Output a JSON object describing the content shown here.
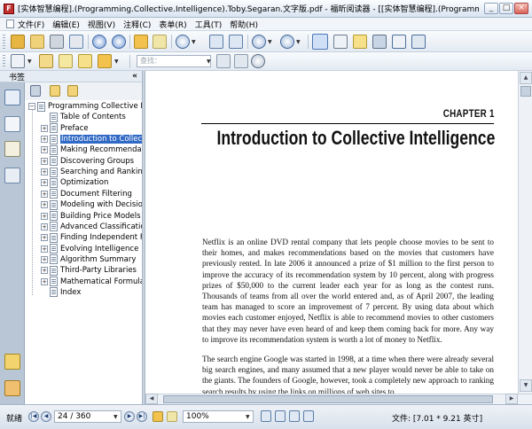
{
  "window": {
    "title": "[实体智慧编程].(Programming.Collective.Intelligence).Toby.Segaran.文字版.pdf - 福昕阅读器 - [[实体智慧编程].(Programming.Coll...",
    "minimize_glyph": "_",
    "maximize_glyph": "□",
    "close_glyph": "×"
  },
  "menu": [
    {
      "label": "文件(F)"
    },
    {
      "label": "编辑(E)"
    },
    {
      "label": "视图(V)"
    },
    {
      "label": "注释(C)"
    },
    {
      "label": "表单(R)"
    },
    {
      "label": "工具(T)"
    },
    {
      "label": "帮助(H)"
    }
  ],
  "toolbar": {
    "find_placeholder": "查找：",
    "icons": [
      "open-icon",
      "save-icon",
      "print-icon",
      "email-icon",
      "page-up-icon",
      "page-down-icon",
      "undo-icon",
      "back-icon",
      "forward-icon",
      "zoom-in-icon",
      "fit-page-icon",
      "fit-width-icon",
      "zoom-out-icon",
      "zoom-in-plus-icon",
      "hand-tool-icon",
      "text-select-icon",
      "highlight-icon",
      "pointer-icon",
      "binocular-icon",
      "text-tool-icon",
      "image-tool-icon",
      "pencil-icon",
      "typewriter-icon",
      "note-icon",
      "textbox-icon",
      "callout-icon",
      "find-prev-icon",
      "find-next-icon",
      "find-zoom-icon"
    ]
  },
  "sidebar": {
    "header": "书签",
    "collapse_glyph": "«",
    "tree_root": "Programming Collective Int",
    "items": [
      {
        "label": "Table of Contents",
        "expandable": false,
        "selected": false
      },
      {
        "label": "Preface",
        "expandable": true,
        "selected": false
      },
      {
        "label": "Introduction to Collecti",
        "expandable": true,
        "selected": true
      },
      {
        "label": "Making Recommendatio",
        "expandable": true,
        "selected": false
      },
      {
        "label": "Discovering Groups",
        "expandable": true,
        "selected": false
      },
      {
        "label": "Searching and Ranking",
        "expandable": true,
        "selected": false
      },
      {
        "label": "Optimization",
        "expandable": true,
        "selected": false
      },
      {
        "label": "Document Filtering",
        "expandable": true,
        "selected": false
      },
      {
        "label": "Modeling with Decision",
        "expandable": true,
        "selected": false
      },
      {
        "label": "Building Price Models",
        "expandable": true,
        "selected": false
      },
      {
        "label": "Advanced Classification:",
        "expandable": true,
        "selected": false
      },
      {
        "label": "Finding Independent Fe",
        "expandable": true,
        "selected": false
      },
      {
        "label": "Evolving Intelligence",
        "expandable": true,
        "selected": false
      },
      {
        "label": "Algorithm Summary",
        "expandable": true,
        "selected": false
      },
      {
        "label": "Third-Party Libraries",
        "expandable": true,
        "selected": false
      },
      {
        "label": "Mathematical Formulas",
        "expandable": true,
        "selected": false
      },
      {
        "label": "Index",
        "expandable": false,
        "selected": false
      }
    ]
  },
  "document": {
    "chapter_label": "CHAPTER 1",
    "chapter_title": "Introduction to Collective Intelligence",
    "paragraph1": "Netflix is an online DVD rental company that lets people choose movies to be sent to their homes, and makes recommendations based on the movies that customers have previously rented. In late 2006 it announced a prize of $1 million to the first person to improve the accuracy of its recommendation system by 10 percent, along with progress prizes of $50,000 to the current leader each year for as long as the contest runs. Thousands of teams from all over the world entered and, as of April 2007, the leading team has managed to score an improvement of 7 percent. By using data about which movies each customer enjoyed, Netflix is able to recommend movies to other customers that they may never have even heard of and keep them coming back for more. Any way to improve its recommendation system is worth a lot of money to Netflix.",
    "paragraph2": "The search engine Google was started in 1998, at a time when there were already several big search engines, and many assumed that a new player would never be able to take on the giants. The founders of Google, however, took a completely new approach to ranking search results by using the links on millions of web sites to"
  },
  "status": {
    "ready": "就绪",
    "page": "24 / 360",
    "zoom": "100%",
    "page_size": "文件: [7.01 * 9.21 英寸]"
  }
}
